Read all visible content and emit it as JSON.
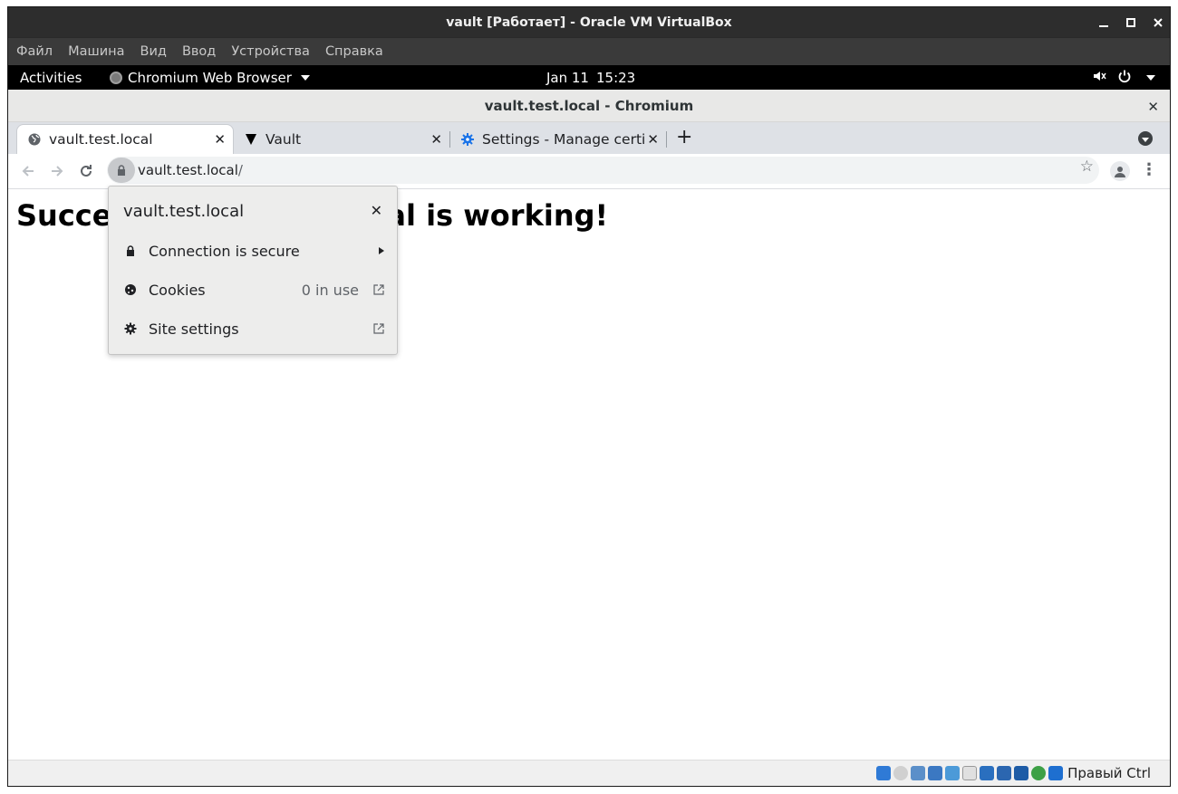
{
  "vbox": {
    "title": "vault [Работает] - Oracle VM VirtualBox",
    "menu": [
      "Файл",
      "Машина",
      "Вид",
      "Ввод",
      "Устройства",
      "Справка"
    ],
    "status_label": "Правый Ctrl"
  },
  "gnome": {
    "activities": "Activities",
    "app_name": "Chromium Web Browser",
    "date": "Jan 11",
    "time": "15:23"
  },
  "chromium": {
    "window_title": "vault.test.local - Chromium",
    "tabs": [
      {
        "label": "vault.test.local",
        "icon": "globe-icon",
        "active": true
      },
      {
        "label": "Vault",
        "icon": "vault-logo-icon",
        "active": false
      },
      {
        "label": "Settings - Manage certi",
        "icon": "gear-icon",
        "active": false
      }
    ],
    "url_host": "vault.test.local",
    "url_path": "/"
  },
  "page": {
    "heading": "Success! vault.test.local is working!"
  },
  "site_info_popup": {
    "title": "vault.test.local",
    "rows": [
      {
        "label": "Connection is secure",
        "value": "",
        "icon": "lock-icon",
        "trail": "chevron-right-icon"
      },
      {
        "label": "Cookies",
        "value": "0 in use",
        "icon": "cookie-icon",
        "trail": "external-link-icon"
      },
      {
        "label": "Site settings",
        "value": "",
        "icon": "gear-icon",
        "trail": "external-link-icon"
      }
    ]
  },
  "colors": {
    "vbox_titlebar": "#2d2d2d",
    "gnome_bar": "#000000",
    "tabstrip": "#dee1e6",
    "popup_bg": "#ededec",
    "settings_icon": "#1a73e8"
  }
}
